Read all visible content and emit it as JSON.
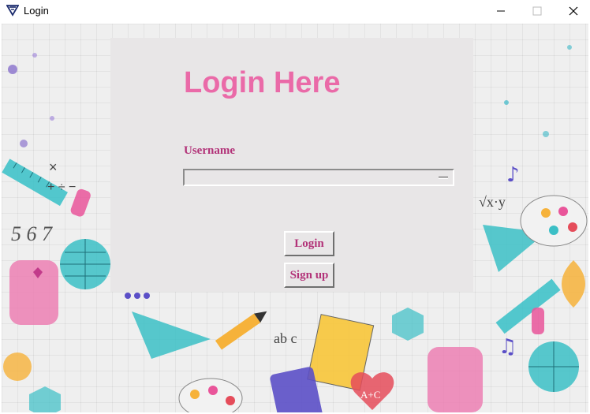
{
  "window": {
    "title": "Login",
    "controls": {
      "minimize": "minimize",
      "maximize": "maximize",
      "close": "close"
    }
  },
  "form": {
    "heading": "Login Here",
    "username_label": "Username",
    "username_value": "",
    "login_button": "Login",
    "signup_button": "Sign up"
  },
  "colors": {
    "heading": "#ea6aa8",
    "label": "#b23278",
    "panel": "#e8e6e7",
    "canvas": "#efefef"
  },
  "decor_text": {
    "numbers": "5 6 7",
    "math": "ab c",
    "heart": "A+C"
  }
}
